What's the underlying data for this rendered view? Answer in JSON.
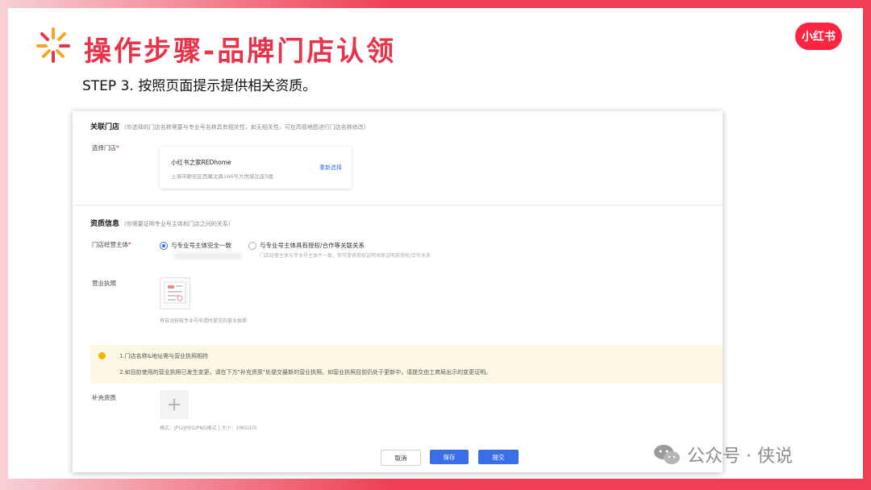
{
  "slide": {
    "title": "操作步骤-品牌门店认领",
    "brand_badge": "小红书",
    "step_text": "STEP 3. 按照页面提示提供相关资质。",
    "watermark": "公众号 · 侠说"
  },
  "form": {
    "linked_store": {
      "heading": "关联门店",
      "note": "(你选择的门店名称需要与专业号名称具有相关性，如无相关性，可在高德地图进行门店名称修改)",
      "select_label": "选择门店",
      "required_mark": "*",
      "store_name": "小红书之家REDhome",
      "store_address": "上海市静安区西藏北路166号大悦城北座5楼",
      "reselect": "重新选择"
    },
    "qualification": {
      "heading": "资质信息",
      "note": "(你需要证明专业号主体和门店之间的关系)",
      "operator_label": "门店经营主体",
      "required_mark": "*",
      "option1": "与专业号主体完全一致",
      "option2": "与专业号主体具有授权/合作等关联关系",
      "option2_sub": "门店经营主体与专业号主体不一致，你可提供授权证明关联证明其授权/合作关系",
      "license_label": "营业执照",
      "license_hint": "将自动获取专业号申请时提交的营业执照"
    },
    "alert": {
      "line1": "1.门店名称&地址需与营业执照相符",
      "line2": "2.如目前使用的营业执照已发生变更，请在下方\"补充资质\"处提交最新的营业执照。如营业执照目前仍处于更新中，请提交由工商局出示的变更证明。"
    },
    "supplement": {
      "label": "补充资质",
      "hint": "格式：JPG/JPEG/PNG格式 | 大小：1MG以内"
    },
    "buttons": {
      "cancel": "取消",
      "save": "保存",
      "submit": "提交"
    }
  },
  "colors": {
    "accent_red": "#e8334a",
    "primary_blue": "#3a6ee8",
    "alert_bg": "#fdf8e4",
    "alert_dot": "#f2b400"
  }
}
